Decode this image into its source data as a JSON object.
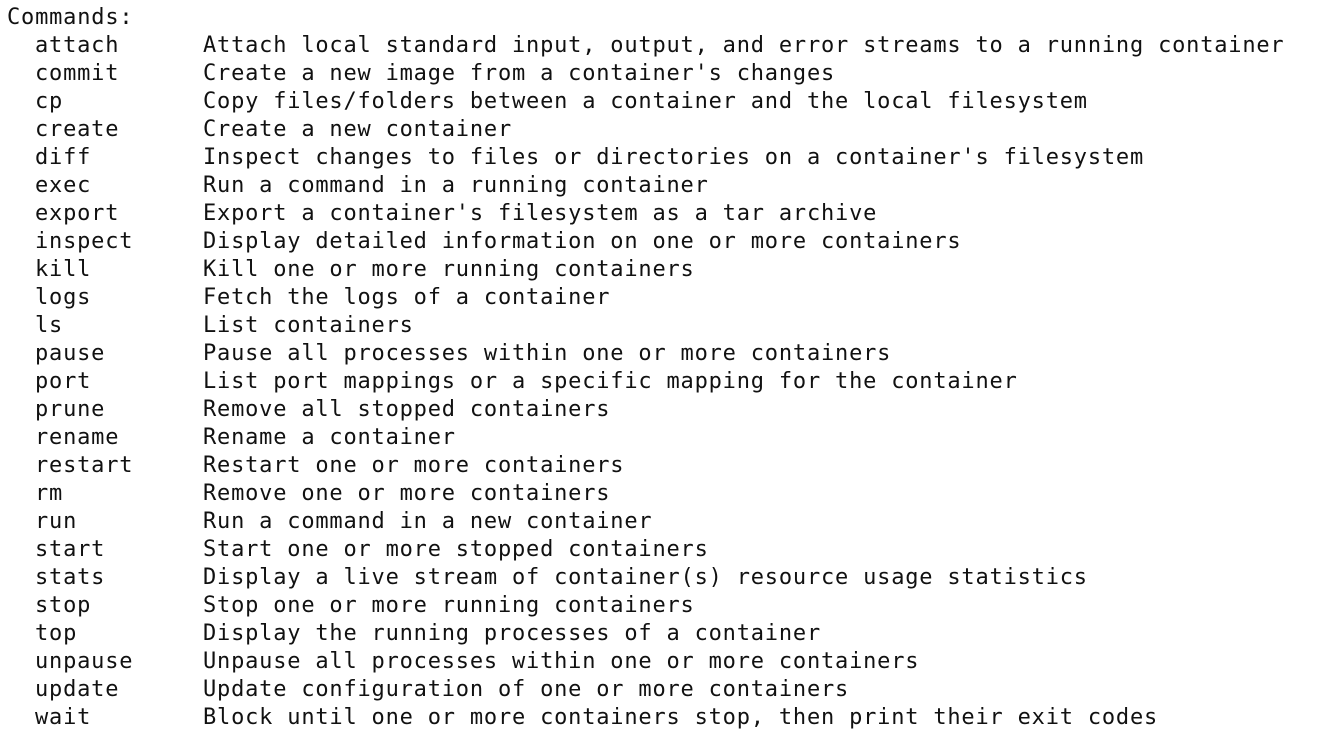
{
  "header": "Commands:",
  "commands": [
    {
      "name": "attach",
      "desc": "Attach local standard input, output, and error streams to a running container"
    },
    {
      "name": "commit",
      "desc": "Create a new image from a container's changes"
    },
    {
      "name": "cp",
      "desc": "Copy files/folders between a container and the local filesystem"
    },
    {
      "name": "create",
      "desc": "Create a new container"
    },
    {
      "name": "diff",
      "desc": "Inspect changes to files or directories on a container's filesystem"
    },
    {
      "name": "exec",
      "desc": "Run a command in a running container"
    },
    {
      "name": "export",
      "desc": "Export a container's filesystem as a tar archive"
    },
    {
      "name": "inspect",
      "desc": "Display detailed information on one or more containers"
    },
    {
      "name": "kill",
      "desc": "Kill one or more running containers"
    },
    {
      "name": "logs",
      "desc": "Fetch the logs of a container"
    },
    {
      "name": "ls",
      "desc": "List containers"
    },
    {
      "name": "pause",
      "desc": "Pause all processes within one or more containers"
    },
    {
      "name": "port",
      "desc": "List port mappings or a specific mapping for the container"
    },
    {
      "name": "prune",
      "desc": "Remove all stopped containers"
    },
    {
      "name": "rename",
      "desc": "Rename a container"
    },
    {
      "name": "restart",
      "desc": "Restart one or more containers"
    },
    {
      "name": "rm",
      "desc": "Remove one or more containers"
    },
    {
      "name": "run",
      "desc": "Run a command in a new container"
    },
    {
      "name": "start",
      "desc": "Start one or more stopped containers"
    },
    {
      "name": "stats",
      "desc": "Display a live stream of container(s) resource usage statistics"
    },
    {
      "name": "stop",
      "desc": "Stop one or more running containers"
    },
    {
      "name": "top",
      "desc": "Display the running processes of a container"
    },
    {
      "name": "unpause",
      "desc": "Unpause all processes within one or more containers"
    },
    {
      "name": "update",
      "desc": "Update configuration of one or more containers"
    },
    {
      "name": "wait",
      "desc": "Block until one or more containers stop, then print their exit codes"
    }
  ]
}
